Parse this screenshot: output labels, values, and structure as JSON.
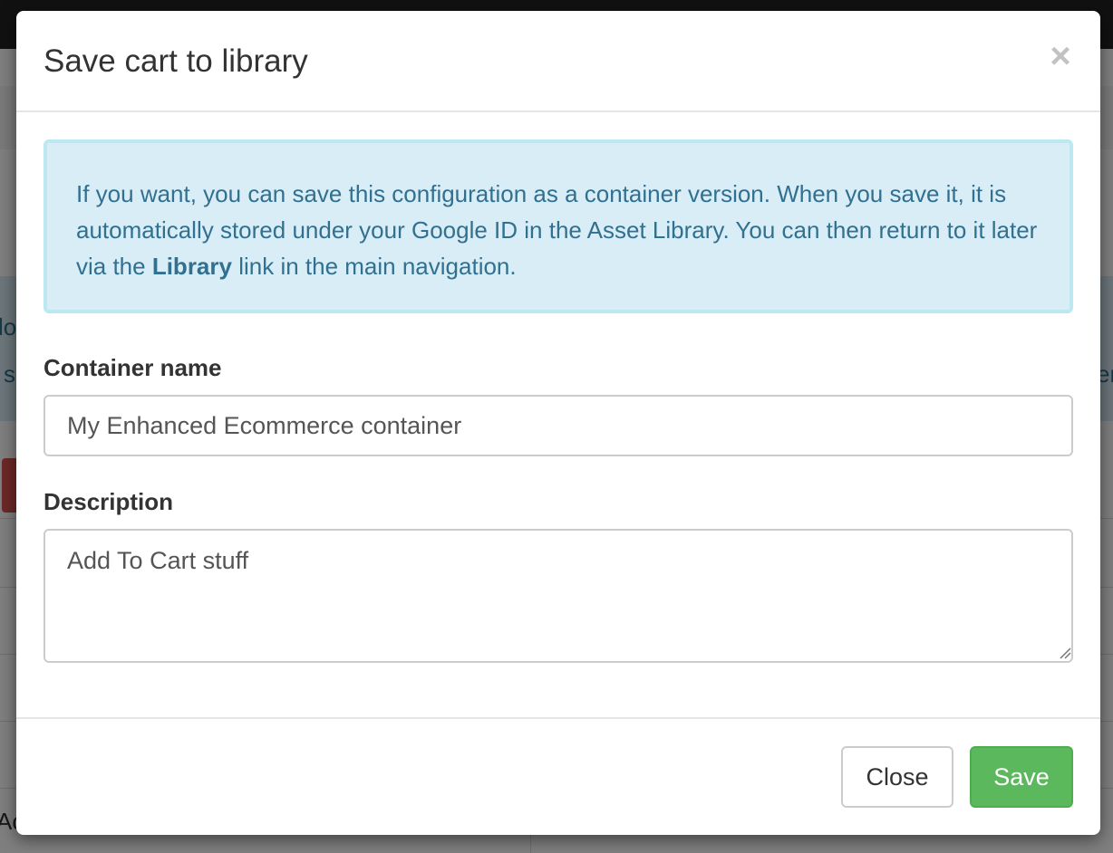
{
  "modal": {
    "title": "Save cart to library",
    "close_symbol": "×",
    "info": {
      "text_before": "If you want, you can save this configuration as a container version. When you save it, it is automatically stored under your Google ID in the Asset Library. You can then return to it later via the ",
      "link_text": "Library",
      "text_after": " link in the main navigation."
    },
    "container_name": {
      "label": "Container name",
      "value": "My Enhanced Ecommerce container"
    },
    "description": {
      "label": "Description",
      "value": "Add To Cart stuff"
    },
    "buttons": {
      "close_label": "Close",
      "save_label": "Save"
    }
  },
  "background": {
    "fragment_1": "lo",
    "fragment_2": "s",
    "fragment_3": "er",
    "fragment_4": "Ac"
  },
  "colors": {
    "save_button": "#5cb85c",
    "info_background": "#d9edf7",
    "info_text": "#31708f"
  },
  "icons": {
    "close": "close-icon",
    "resize": "resize-grip-icon"
  }
}
